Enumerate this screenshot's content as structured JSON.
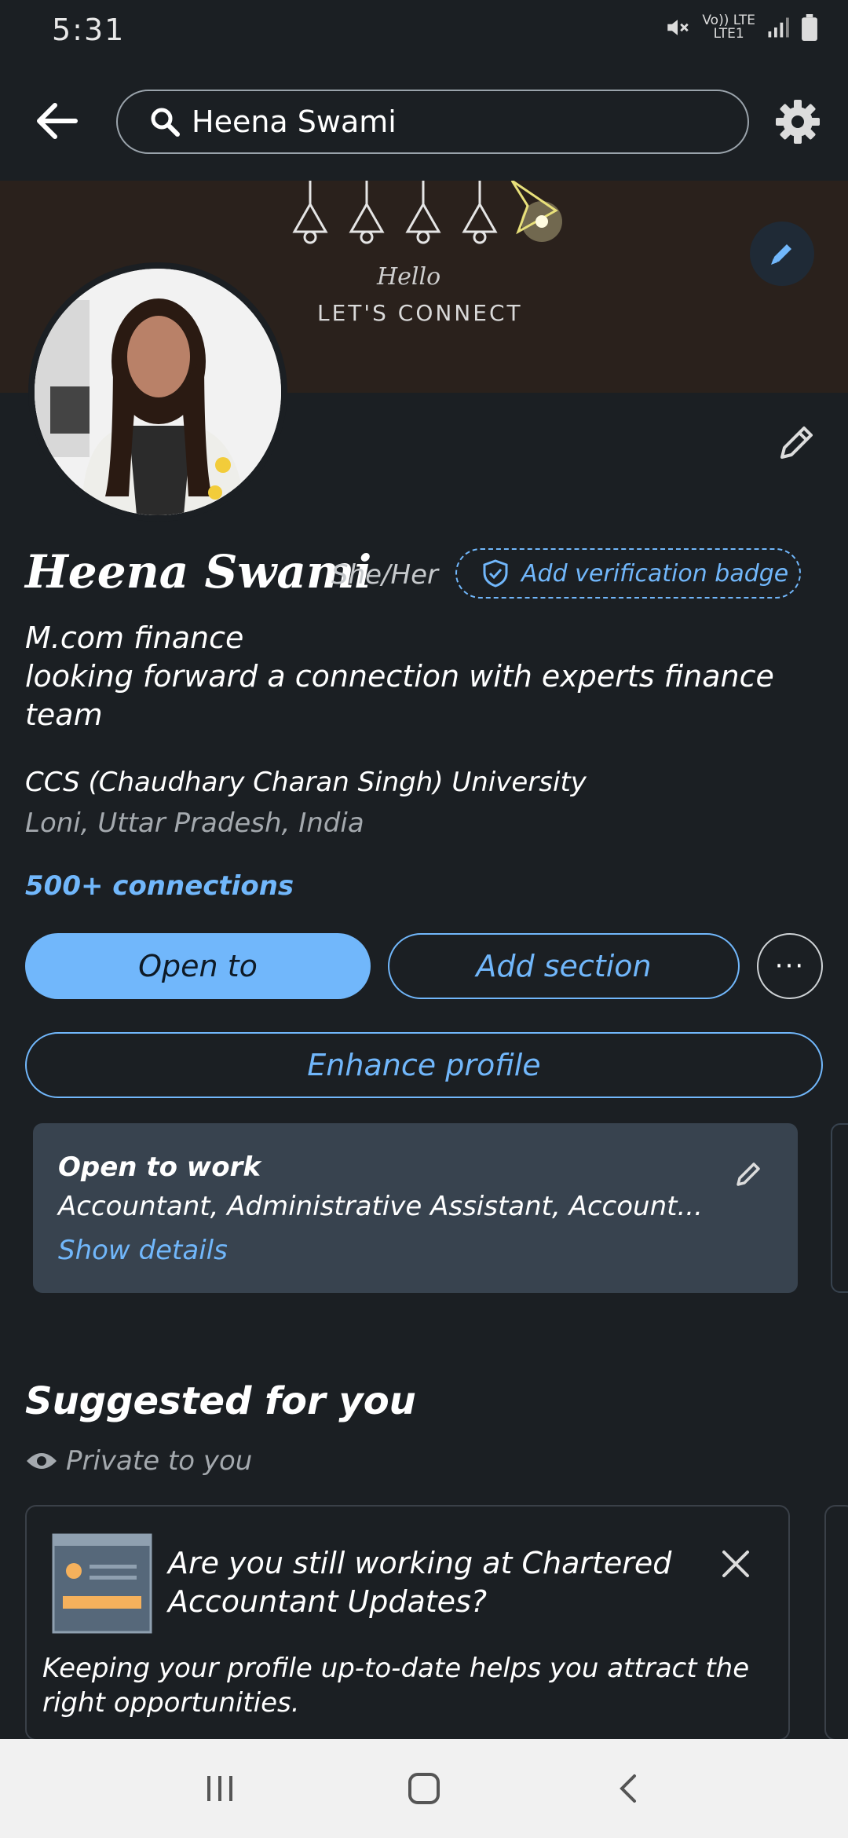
{
  "status_bar": {
    "time": "5:31",
    "signal_label_top": "Vo)) LTE",
    "signal_label_bottom": "LTE1"
  },
  "search": {
    "query": "Heena Swami"
  },
  "banner": {
    "hello": "Hello",
    "connect": "LET'S CONNECT"
  },
  "profile": {
    "name": "Heena Swami",
    "pronouns": "She/Her",
    "verification_label": "Add verification badge",
    "headline": "M.com finance\nlooking forward a connection with experts finance team",
    "education": "CCS (Chaudhary Charan Singh) University",
    "location": "Loni, Uttar Pradesh, India",
    "connections": "500+ connections"
  },
  "actions": {
    "open_to": "Open to",
    "add_section": "Add section",
    "more": "···",
    "enhance": "Enhance profile"
  },
  "open_to_work": {
    "title": "Open to work",
    "roles": "Accountant, Administrative Assistant, Account...",
    "link": "Show details"
  },
  "suggested": {
    "title": "Suggested for you",
    "private_note": "Private to you",
    "card_question": "Are you still working at Chartered Accountant Updates?",
    "card_body": "Keeping your profile up-to-date helps you attract the right opportunities."
  },
  "colors": {
    "background": "#1b1f23",
    "accent": "#71b7fb",
    "card": "#38434f",
    "banner": "#2a211c"
  }
}
